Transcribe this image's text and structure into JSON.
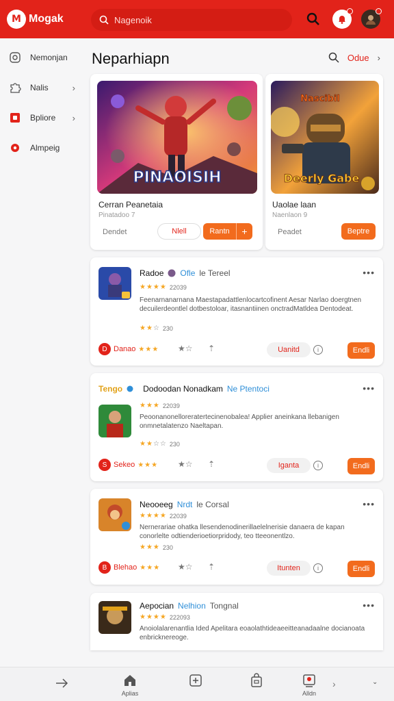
{
  "header": {
    "logo_mark": "M",
    "app_name": "Mogak",
    "search_placeholder": "Nagenoik",
    "colors": {
      "brand": "#e2231a",
      "accent": "#f26b1d"
    }
  },
  "sidebar": {
    "items": [
      {
        "label": "Nemonjan",
        "icon": "grid-icon"
      },
      {
        "label": "Nalis",
        "icon": "puzzle-icon"
      },
      {
        "label": "Bpliore",
        "icon": "app-icon"
      },
      {
        "label": "Almpeig",
        "icon": "record-icon"
      }
    ]
  },
  "main": {
    "title": "Neparhiapn",
    "link": "Odue",
    "featured": [
      {
        "art_text": "PINAOISIH",
        "title": "Cerran Peanetaia",
        "subtitle": "Pinatadoo 7",
        "detail": "Dendet",
        "btn_outline": "Nlell",
        "btn_action": "Rantn",
        "btn_plus": "+"
      },
      {
        "art_text_top": "Nascibil",
        "art_text_bottom": "Deerly Gabe",
        "title": "Uaolae laan",
        "subtitle": "Naenlaon 9",
        "detail": "Peadet",
        "btn_action": "Beptre"
      }
    ],
    "apps": [
      {
        "title": "Radoe",
        "tag": "Ofle",
        "tag2": "le Tereel",
        "rating_count": "22039",
        "description": "Feenarnanarnana Maestapadattlenlocartcofinent Aesar Narlao doergtnen decuilerdeontlel dotbestoloar, itasnantiinen onctradMatldea Dentodeat.",
        "rating2_count": "230",
        "badge": "Danao",
        "install_text": "Uanitd",
        "install_btn": "Endli"
      },
      {
        "title_prefix": "Tengo",
        "title": "Dodoodan Nonadkam",
        "tag": "Ne Ptentoci",
        "rating_count": "22039",
        "description": "Peoonanonelloreratertecinenobalea! Applier aneinkana llebanigen onmnetalatenzo Naeltapan.",
        "rating2_count": "230",
        "badge": "Sekeo",
        "install_text": "Iganta",
        "install_btn": "Endli"
      },
      {
        "title": "Neooeeg",
        "tag": "Nrdt",
        "tag2": "le Corsal",
        "rating_count": "22039",
        "description": "Nernerariae ohatka llesendenodinerillaelelnerisie danaera de kapan conorlelte odtienderioetiorpridody, teo tteeonentlzo.",
        "rating2_count": "230",
        "badge": "Blehao",
        "install_text": "Itunten",
        "install_btn": "Endli"
      },
      {
        "title": "Aepocian",
        "tag": "Nelhion",
        "tag2": "Tongnal",
        "rating_count": "222093",
        "description": "Anoiolalarenantlia Ided Apelitara eoaolathtideaeeitteanadaalne docianoata enbricknereoge."
      }
    ]
  },
  "bottom_nav": {
    "items": [
      {
        "label": "",
        "icon": "arrow-right-icon"
      },
      {
        "label": "Aplias",
        "icon": "home-icon"
      },
      {
        "label": "",
        "icon": "plus-square-icon"
      },
      {
        "label": "",
        "icon": "bag-icon"
      },
      {
        "label": "Alldn",
        "icon": "profile-icon"
      }
    ]
  }
}
